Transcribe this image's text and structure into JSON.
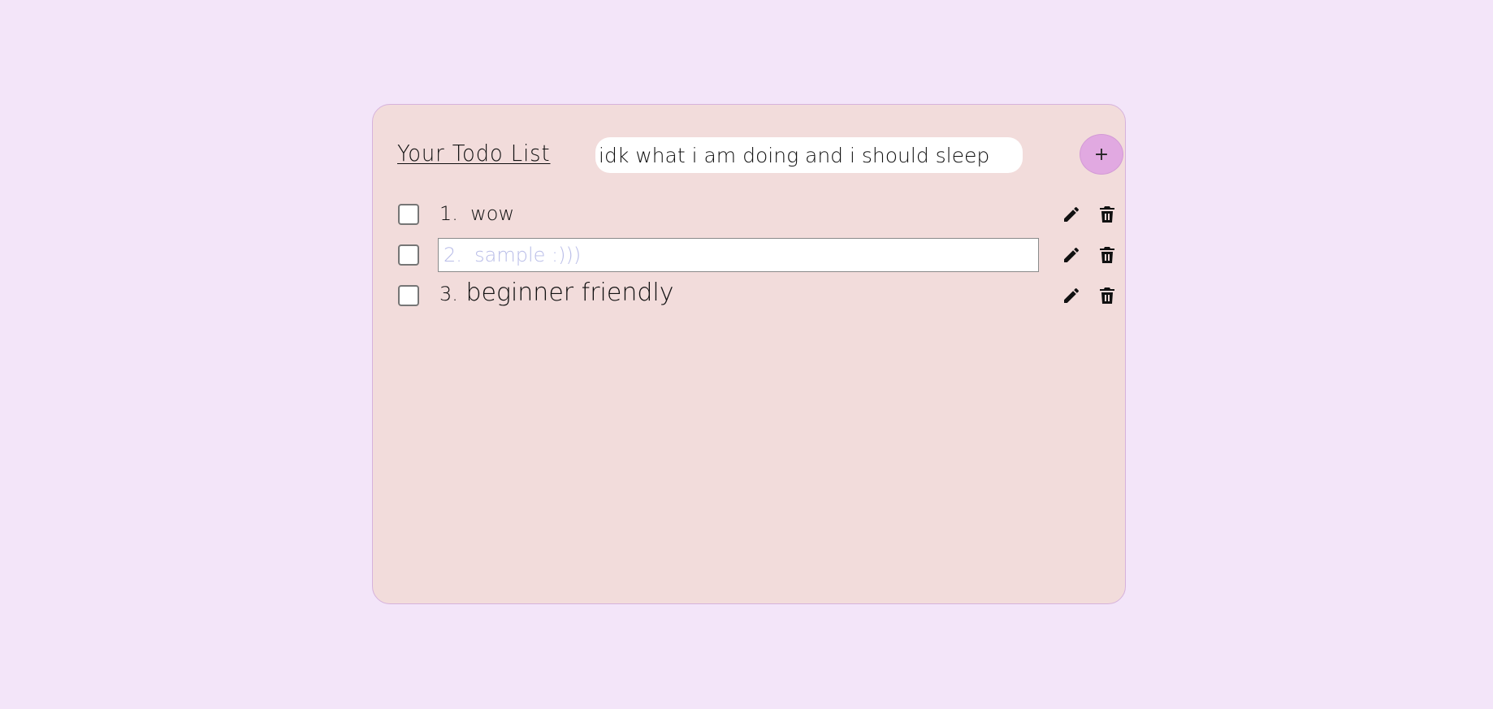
{
  "header": {
    "title": "Your Todo List",
    "new_todo_value": "idk what i am doing and i should sleep",
    "add_button_label": "+"
  },
  "todos": [
    {
      "number": "1.",
      "text": "wow",
      "checked": false,
      "editing": false
    },
    {
      "number": "2.",
      "placeholder": "2.  sample :)))",
      "checked": false,
      "editing": true
    },
    {
      "number": "3.",
      "text": "beginner friendly",
      "checked": false,
      "editing": false
    }
  ],
  "colors": {
    "page_background": "#f3e5f9",
    "card_background": "#f2dcdb",
    "card_border": "#d6b2dc",
    "add_button": "#e1a9e1",
    "placeholder": "#b9bde8"
  },
  "icons": {
    "edit": "pencil-icon",
    "delete": "trash-icon"
  }
}
